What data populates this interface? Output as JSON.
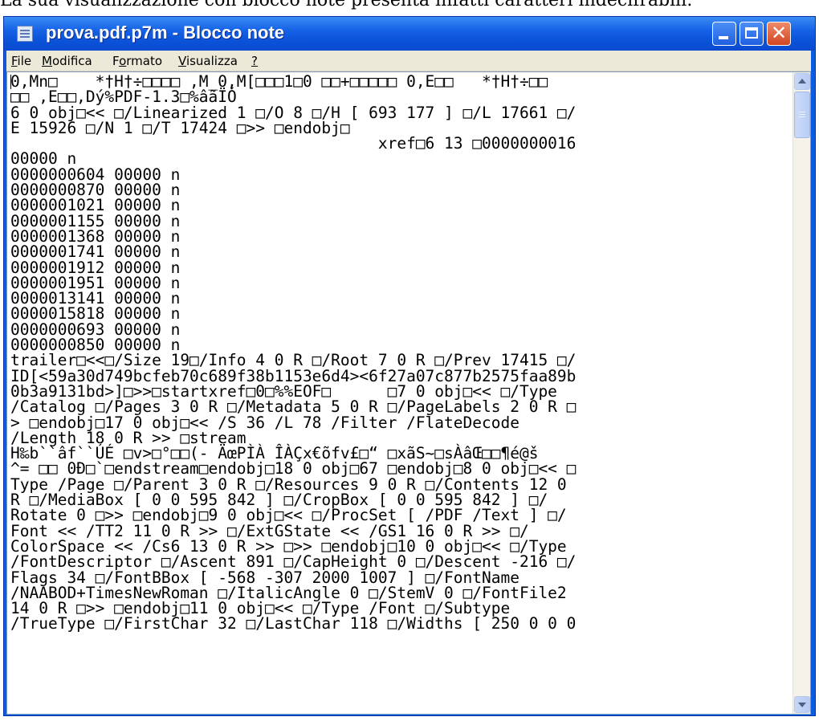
{
  "caption": "La sua visualizzazione con blocco note presenta infatti caratteri indecifrabili:",
  "window": {
    "title": "prova.pdf.p7m - Blocco note"
  },
  "menu": [
    {
      "label_ul": "F",
      "label_rest": "ile"
    },
    {
      "label_ul": "M",
      "label_rest": "odifica"
    },
    {
      "label_pre": "F",
      "label_ul": "o",
      "label_rest": "rmato"
    },
    {
      "label_ul": "V",
      "label_rest": "isualizza"
    },
    {
      "label_ul": "?",
      "label_rest": ""
    }
  ],
  "content": {
    "lines": [
      "0,Mn□    *†H†÷□□□□ ,M_0,M[□□□1□0 □□+□□□□□ 0,E□□   *†H†÷□□",
      "□□ ,E□□,Dý%PDF-1.3□%âãÏÓ",
      "6 0 obj□<< □/Linearized 1 □/O 8 □/H [ 693 177 ] □/L 17661 □/",
      "E 15926 □/N 1 □/T 17424 □>> □endobj□",
      "                                       xref□6 13 □0000000016",
      "00000 n",
      "0000000604 00000 n",
      "0000000870 00000 n",
      "0000001021 00000 n",
      "0000001155 00000 n",
      "0000001368 00000 n",
      "0000001741 00000 n",
      "0000001912 00000 n",
      "0000001951 00000 n",
      "0000013141 00000 n",
      "0000015818 00000 n",
      "0000000693 00000 n",
      "0000000850 00000 n",
      "trailer□<<□/Size 19□/Info 4 0 R □/Root 7 0 R □/Prev 17415 □/",
      "ID[<59a30d749bcfeb70c689f38b1153e6d4><6f27a07c877b2575faa89b",
      "0b3a9131bd>]□>>□startxref□0□%%EOF□      □7 0 obj□<< □/Type",
      "/Catalog □/Pages 3 0 R □/Metadata 5 0 R □/PageLabels 2 0 R □",
      "> □endobj□17 0 obj□<< /S 36 /L 78 /Filter /FlateDecode",
      "/Length 18 0 R >> □stream",
      "H‰b``âf``ÚÉ □v>□°□□(- ÄœPÌÀ ÎÀÇx€õfv£□“ □xãS~□sÀâŒ□□¶é@š",
      "^= □□ 0Ð□`□endstream□endobj□18 0 obj□67 □endobj□8 0 obj□<< □",
      "Type /Page □/Parent 3 0 R □/Resources 9 0 R □/Contents 12 0",
      "R □/MediaBox [ 0 0 595 842 ] □/CropBox [ 0 0 595 842 ] □/",
      "Rotate 0 □>> □endobj□9 0 obj□<< □/ProcSet [ /PDF /Text ] □/",
      "Font << /TT2 11 0 R >> □/ExtGState << /GS1 16 0 R >> □/",
      "ColorSpace << /Cs6 13 0 R >> □>> □endobj□10 0 obj□<< □/Type",
      "/FontDescriptor □/Ascent 891 □/CapHeight 0 □/Descent -216 □/",
      "Flags 34 □/FontBBox [ -568 -307 2000 1007 ] □/FontName",
      "/NAABOD+TimesNewRoman □/ItalicAngle 0 □/StemV 0 □/FontFile2",
      "14 0 R □>> □endobj□11 0 obj□<< □/Type /Font □/Subtype",
      "/TrueType □/FirstChar 32 □/LastChar 118 □/Widths [ 250 0 0 0"
    ]
  }
}
